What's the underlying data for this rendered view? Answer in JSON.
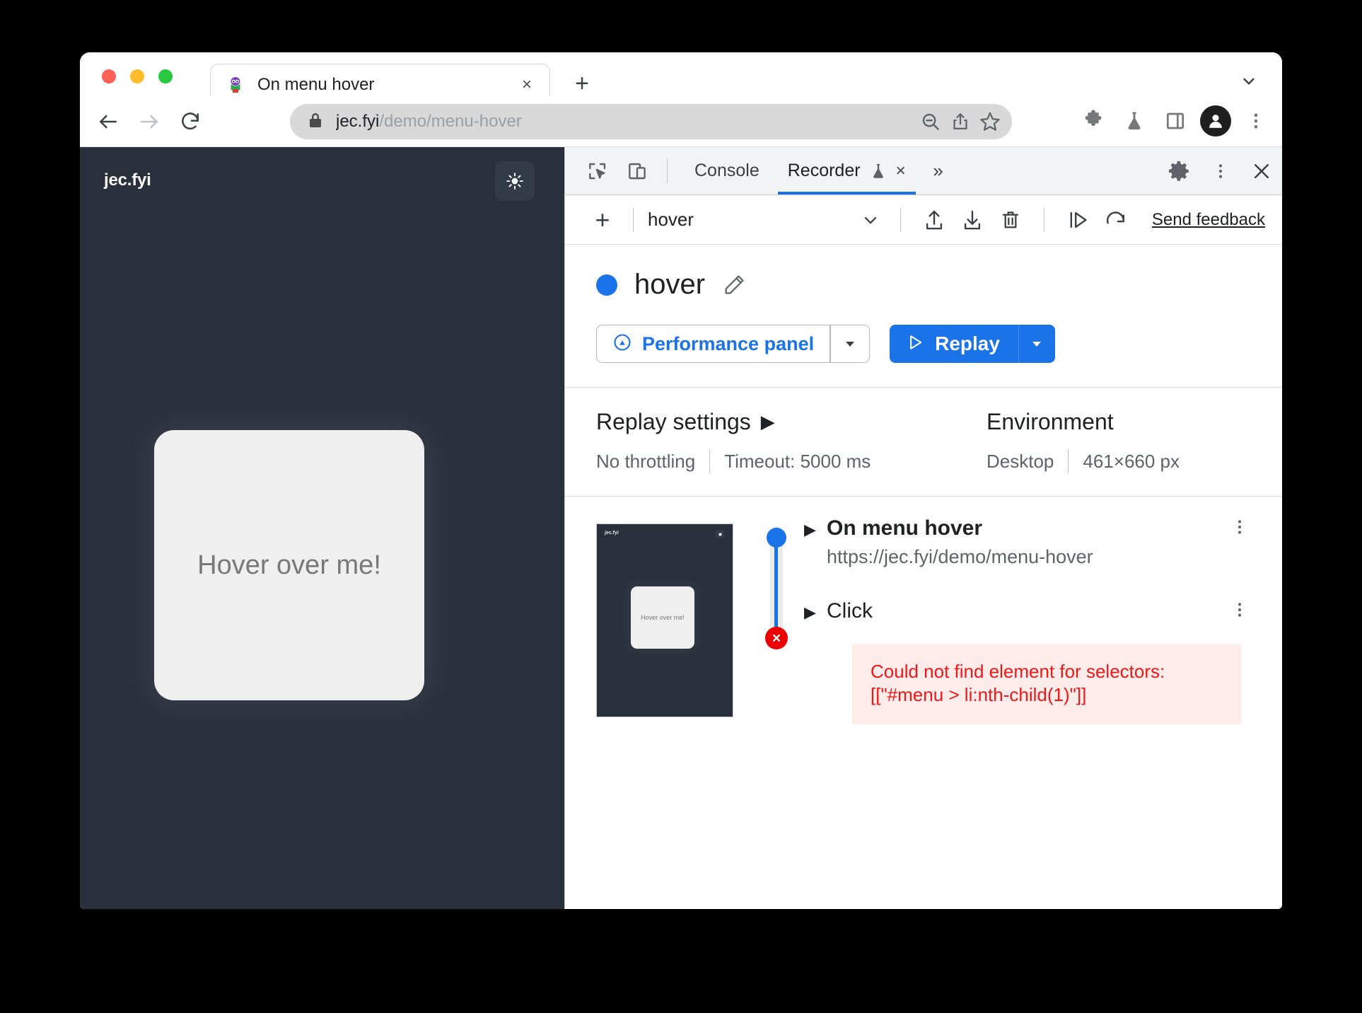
{
  "browser": {
    "tab": {
      "title": "On menu hover",
      "favicon_name": "site-favicon",
      "close_label": "×"
    },
    "new_tab_label": "+",
    "tab_list_icon": "chevron-down-icon",
    "omnibox": {
      "lock_icon": "lock-icon",
      "url_host": "jec.fyi",
      "url_path": "/demo/menu-hover",
      "actions": [
        "zoom-out-icon",
        "share-icon",
        "bookmark-star-icon"
      ]
    },
    "toolbar_icons": [
      "extensions-puzzle-icon",
      "experiments-flask-icon",
      "side-panel-icon",
      "avatar-icon",
      "browser-menu-icon"
    ],
    "nav": {
      "back": "back-arrow-icon",
      "forward": "forward-arrow-icon",
      "reload": "reload-icon"
    }
  },
  "page": {
    "logo": "jec.fyi",
    "theme_toggle_icon": "sun-icon",
    "card_label": "Hover over me!",
    "background_color": "#292f3b",
    "card_color": "#efeff0"
  },
  "devtools": {
    "tools": [
      "inspect-element-icon",
      "device-toolbar-icon"
    ],
    "tabs": [
      {
        "label": "Console",
        "active": false
      },
      {
        "label": "Recorder",
        "active": true,
        "badge_icon": "experiment-flask-icon",
        "close_label": "×"
      }
    ],
    "more_tabs_label": "»",
    "right_actions": [
      "settings-gear-icon",
      "devtools-menu-icon",
      "close-devtools-icon"
    ],
    "close_label": "×"
  },
  "recorder": {
    "toolbar": {
      "add_label": "+",
      "recording_name": "hover",
      "chevron_icon": "chevron-down-icon",
      "export_icon": "export-icon",
      "import_icon": "import-icon",
      "delete_icon": "trash-icon",
      "step_by_step_icon": "replay-step-icon",
      "replay_again_icon": "replay-again-icon",
      "feedback_label": "Send feedback"
    },
    "header": {
      "status_color": "#1a73e8",
      "title": "hover",
      "edit_icon": "pencil-edit-icon",
      "performance_button": {
        "label": "Performance panel",
        "icon": "performance-speedometer-icon",
        "dropdown_icon": "chevron-down-icon"
      },
      "replay_button": {
        "label": "Replay",
        "icon": "play-triangle-icon",
        "dropdown_icon": "chevron-down-icon"
      }
    },
    "settings": {
      "replay": {
        "heading": "Replay settings",
        "expand_icon": "▶",
        "throttling": "No throttling",
        "timeout": "Timeout: 5000 ms"
      },
      "environment": {
        "heading": "Environment",
        "device": "Desktop",
        "viewport": "461×660 px"
      }
    },
    "screenshot": {
      "logo": "jec.fyi",
      "toggle_icon": "sun-icon",
      "card_label": "Hover over me!"
    },
    "steps": [
      {
        "expand_icon": "▶",
        "title": "On menu hover",
        "subtitle": "https://jec.fyi/demo/menu-hover",
        "status": "success",
        "menu_icon": "kebab-menu-icon"
      },
      {
        "expand_icon": "▶",
        "title": "Click",
        "subtitle": "",
        "status": "error",
        "error_marker": "×",
        "menu_icon": "kebab-menu-icon"
      }
    ],
    "error": {
      "line1": "Could not find element for selectors:",
      "line2": "[[\"#menu > li:nth-child(1)\"]]",
      "text_color": "#f01818",
      "background_color": "#fdecea"
    }
  }
}
